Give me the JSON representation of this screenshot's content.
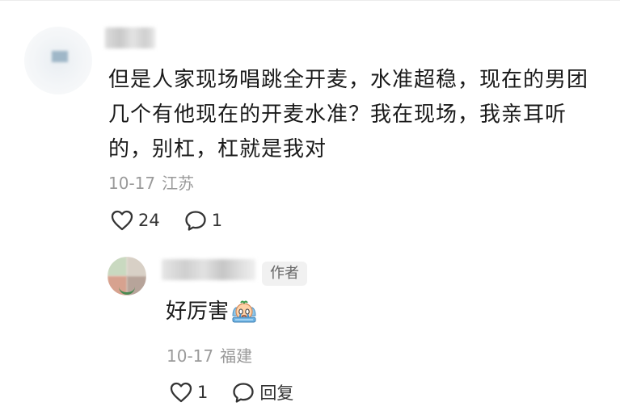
{
  "comment": {
    "text": "但是人家现场唱跳全开麦，水准超稳，现在的男团几个有他现在的开麦水准？我在现场，我亲耳听的，别杠，杠就是我对",
    "date": "10-17",
    "location": "江苏",
    "like_count": "24",
    "reply_count": "1",
    "icons": {
      "like": "heart-outline-icon",
      "reply": "speech-bubble-icon"
    }
  },
  "reply": {
    "author_badge": "作者",
    "text": "好厉害",
    "emoji": "crying-emoji",
    "date": "10-17",
    "location": "福建",
    "like_count": "1",
    "reply_label": "回复",
    "icons": {
      "like": "heart-outline-icon",
      "reply": "speech-bubble-icon"
    }
  }
}
